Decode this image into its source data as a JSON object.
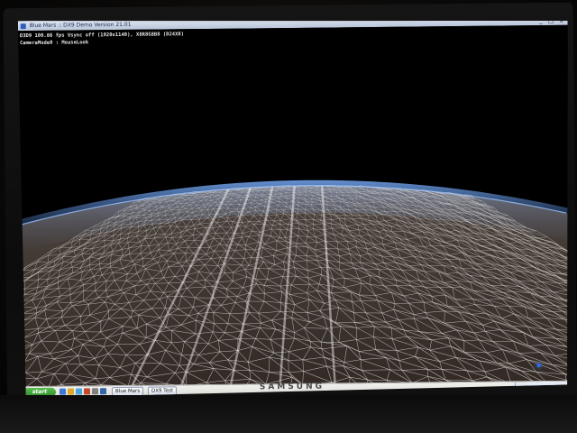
{
  "window": {
    "title": "Blue Mars :: DX9 Demo Version 21.01",
    "controls": "_ □ x"
  },
  "hud": {
    "line1": "D3D9 100.86 fps Vsync off (1920x1140), X8R8G8B8 (D24X8)",
    "line2": "CameraMode0 : MouseLook"
  },
  "scene": {
    "description_colors": {
      "wire": "#e6e2dc",
      "atmosphere": "#3b6fb8",
      "ground": "#6a5a50"
    }
  },
  "taskbar": {
    "start_label": "start",
    "items": [
      {
        "label": "Blue Mars"
      },
      {
        "label": "DX9 Test"
      }
    ]
  },
  "bezel": {
    "brand": "SAMSUNG"
  }
}
